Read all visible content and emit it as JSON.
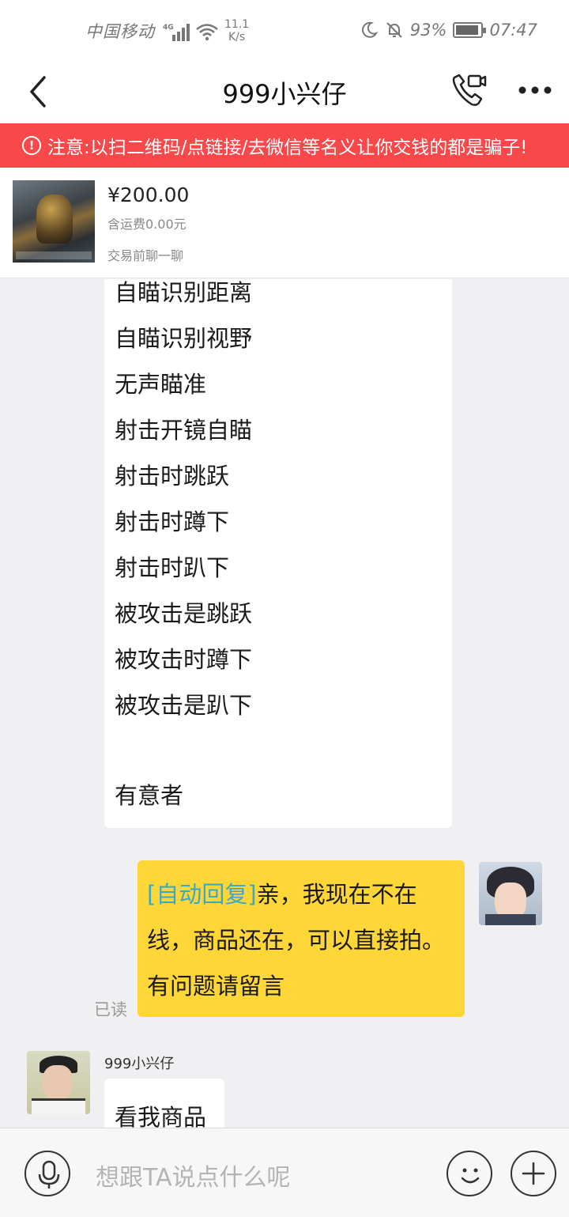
{
  "status_bar": {
    "carrier": "中国移动",
    "network": "4G",
    "speed_value": "11.1",
    "speed_unit": "K/s",
    "battery": "93%",
    "battery_level": 0.93,
    "time": "07:47"
  },
  "nav": {
    "title": "999小兴仔",
    "icons": [
      "back-arrow-icon",
      "video-call-icon",
      "more-icon"
    ]
  },
  "warning": {
    "icon": "!",
    "text": "注意:以扫二维码/点链接/去微信等名义让你交钱的都是骗子!"
  },
  "product": {
    "price": "¥200.00",
    "shipping": "含运费0.00元",
    "chat_hint": "交易前聊一聊"
  },
  "messages": {
    "incoming_lines": [
      "自瞄识别距离",
      "自瞄识别视野",
      "无声瞄准",
      "射击开镜自瞄",
      "射击时跳跃",
      "射击时蹲下",
      "射击时趴下",
      "被攻击是跳跃",
      "被攻击时蹲下",
      "被攻击是趴下",
      "",
      "有意者"
    ],
    "auto_reply_tag": "[自动回复]",
    "auto_reply_text": "亲，我现在不在线，商品还在，可以直接拍。有问题请留言",
    "read_status": "已读",
    "sender_name": "999小兴仔",
    "last_message": "看我商品"
  },
  "input": {
    "placeholder": "想跟TA说点什么呢",
    "icons": [
      "microphone-icon",
      "emoji-icon",
      "plus-icon"
    ]
  },
  "colors": {
    "warning_bg": "#f9484a",
    "own_bubble": "#ffd638",
    "auto_tag": "#3aa9c9",
    "chat_bg": "#f0f0f3"
  }
}
